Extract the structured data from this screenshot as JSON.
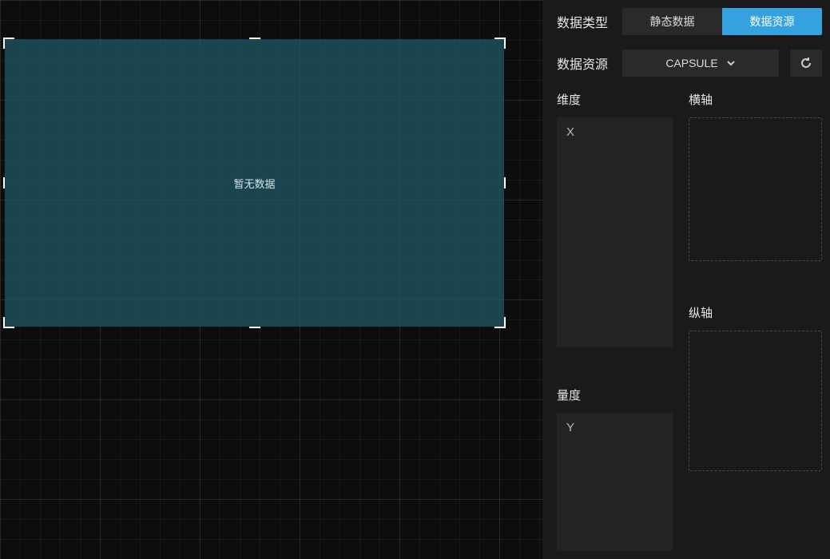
{
  "canvas": {
    "no_data_text": "暂无数据"
  },
  "panel": {
    "data_type_label": "数据类型",
    "static_data_label": "静态数据",
    "data_resource_label": "数据资源",
    "resource_row_label": "数据资源",
    "resource_dropdown_value": "CAPSULE",
    "dimension_label": "维度",
    "dimension_items": [
      "X"
    ],
    "measure_label": "量度",
    "measure_items": [
      "Y"
    ],
    "horizontal_axis_label": "横轴",
    "vertical_axis_label": "纵轴"
  },
  "colors": {
    "accent": "#33a2df"
  }
}
